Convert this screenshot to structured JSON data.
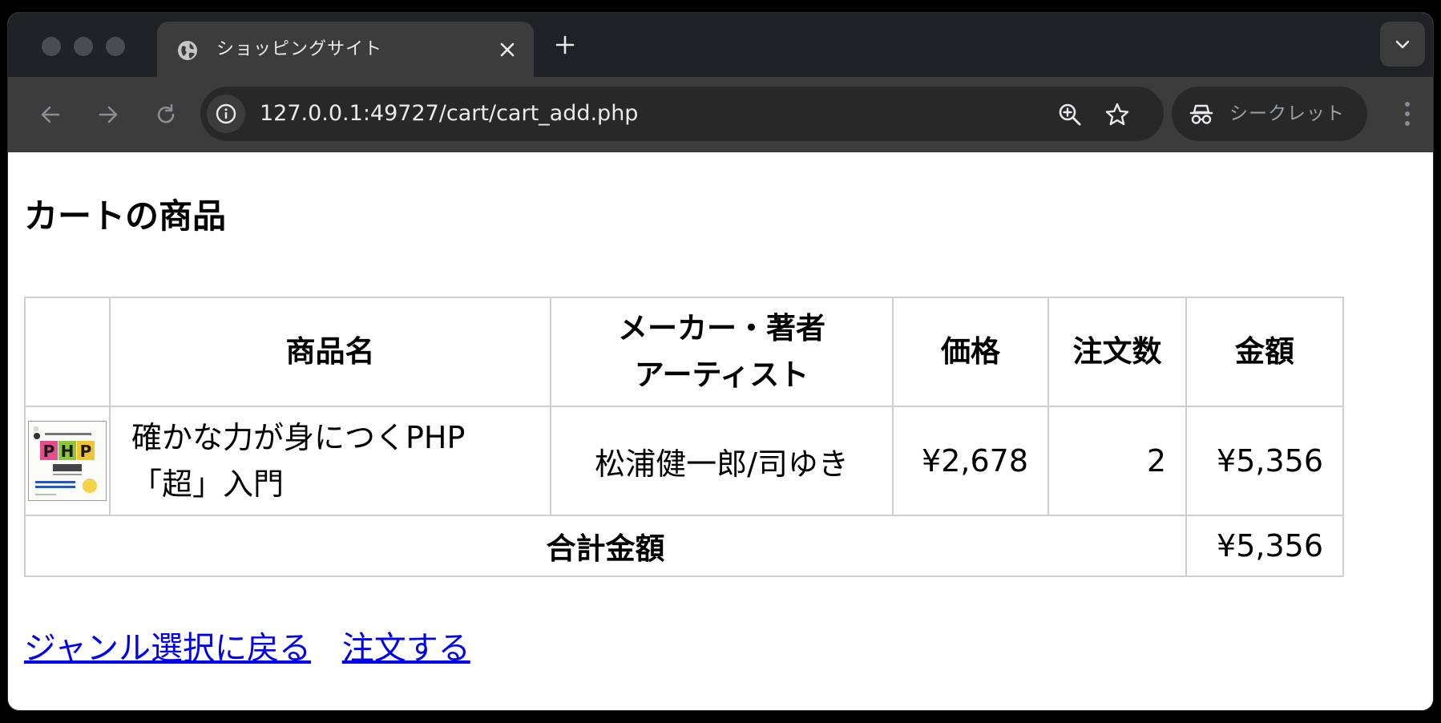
{
  "browser": {
    "tab_title": "ショッピングサイト",
    "url": "127.0.0.1:49727/cart/cart_add.php",
    "incognito_label": "シークレット",
    "colors": {
      "tabstrip": "#202124",
      "toolbar": "#3c3c3c",
      "omnibox": "#282828"
    }
  },
  "icons": {
    "tab": "globe-icon",
    "close": "close-icon",
    "new_tab": "plus-icon",
    "back": "arrow-left-icon",
    "forward": "arrow-right-icon",
    "reload": "reload-icon",
    "site_info": "info-icon",
    "zoom": "zoom-in-icon",
    "bookmark": "star-icon",
    "incognito": "incognito-icon",
    "menu": "kebab-icon"
  },
  "page": {
    "title": "カートの商品",
    "table": {
      "headers": {
        "image": "",
        "name": "商品名",
        "maker_line1": "メーカー・著者",
        "maker_line2": "アーティスト",
        "price": "価格",
        "quantity": "注文数",
        "amount": "金額"
      },
      "rows": [
        {
          "name_line1": "確かな力が身につくPHP",
          "name_line2": "「超」入門",
          "maker": "松浦健一郎/司ゆき",
          "price": "¥2,678",
          "quantity": "2",
          "amount": "¥5,356"
        }
      ],
      "total_label": "合計金額",
      "total_value": "¥5,356"
    },
    "links": {
      "back": "ジャンル選択に戻る",
      "order": "注文する"
    },
    "colors": {
      "link": "#0000ee",
      "border": "#cfcfcf"
    }
  }
}
